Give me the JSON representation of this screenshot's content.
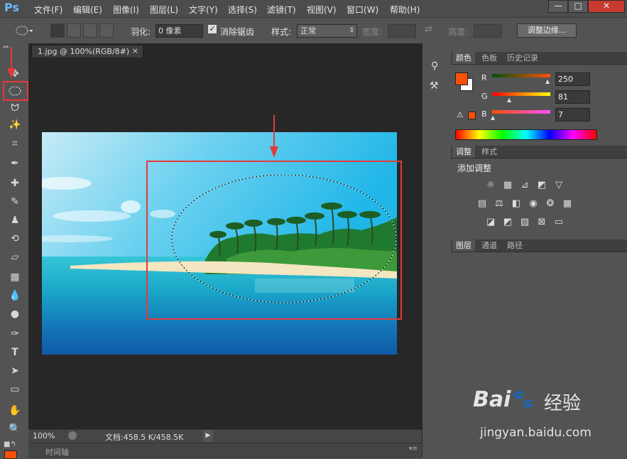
{
  "app": {
    "logo": "Ps"
  },
  "menu": [
    "文件(F)",
    "编辑(E)",
    "图像(I)",
    "图层(L)",
    "文字(Y)",
    "选择(S)",
    "滤镜(T)",
    "视图(V)",
    "窗口(W)",
    "帮助(H)"
  ],
  "window_buttons": [
    "—",
    "□",
    "✕"
  ],
  "options": {
    "feather_label": "羽化:",
    "feather_value": "0 像素",
    "antialias_label": "消除锯齿",
    "style_label": "样式:",
    "style_value": "正常",
    "width_label": "宽度:",
    "height_label": "高度:",
    "refine_edge": "调整边缘..."
  },
  "document": {
    "tab_title": "1.jpg @ 100%(RGB/8#)",
    "tab_close": "×",
    "zoom": "100%",
    "doc_info": "文档:458.5 K/458.5K",
    "timeline_label": "时间轴"
  },
  "color_panel": {
    "tabs": [
      "颜色",
      "色板",
      "历史记录"
    ],
    "labels": [
      "R",
      "G",
      "B"
    ],
    "values": [
      "250",
      "81",
      "7"
    ],
    "foreground": "#fa5107"
  },
  "adjust_panel": {
    "tabs": [
      "调整",
      "样式"
    ],
    "title": "添加调整"
  },
  "layers_panel": {
    "tabs": [
      "图层",
      "通道",
      "路径"
    ]
  },
  "watermark": {
    "brand": "Bai",
    "brand2": "经验",
    "url": "jingyan.baidu.com"
  },
  "colors": {
    "accent_red": "#e43a3a",
    "ps_blue": "#6fb7ff"
  }
}
